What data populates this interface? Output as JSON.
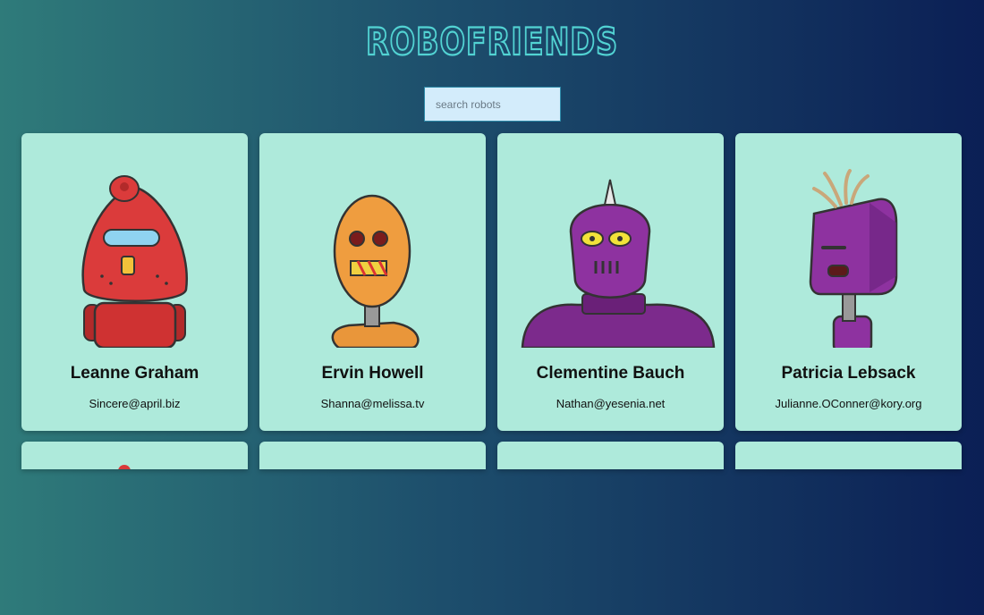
{
  "app": {
    "title": "ROBOFRIENDS"
  },
  "search": {
    "placeholder": "search robots",
    "value": ""
  },
  "robots": [
    {
      "name": "Leanne Graham",
      "email": "Sincere@april.biz",
      "color": "#d93a3a"
    },
    {
      "name": "Ervin Howell",
      "email": "Shanna@melissa.tv",
      "color": "#ee9a3c"
    },
    {
      "name": "Clementine Bauch",
      "email": "Nathan@yesenia.net",
      "color": "#8a2f9a"
    },
    {
      "name": "Patricia Lebsack",
      "email": "Julianne.OConner@kory.org",
      "color": "#8a2f9a"
    }
  ],
  "colors": {
    "card": "#aeeadb",
    "logo": "#52d3d3",
    "search_bg": "#d3ecfb"
  }
}
